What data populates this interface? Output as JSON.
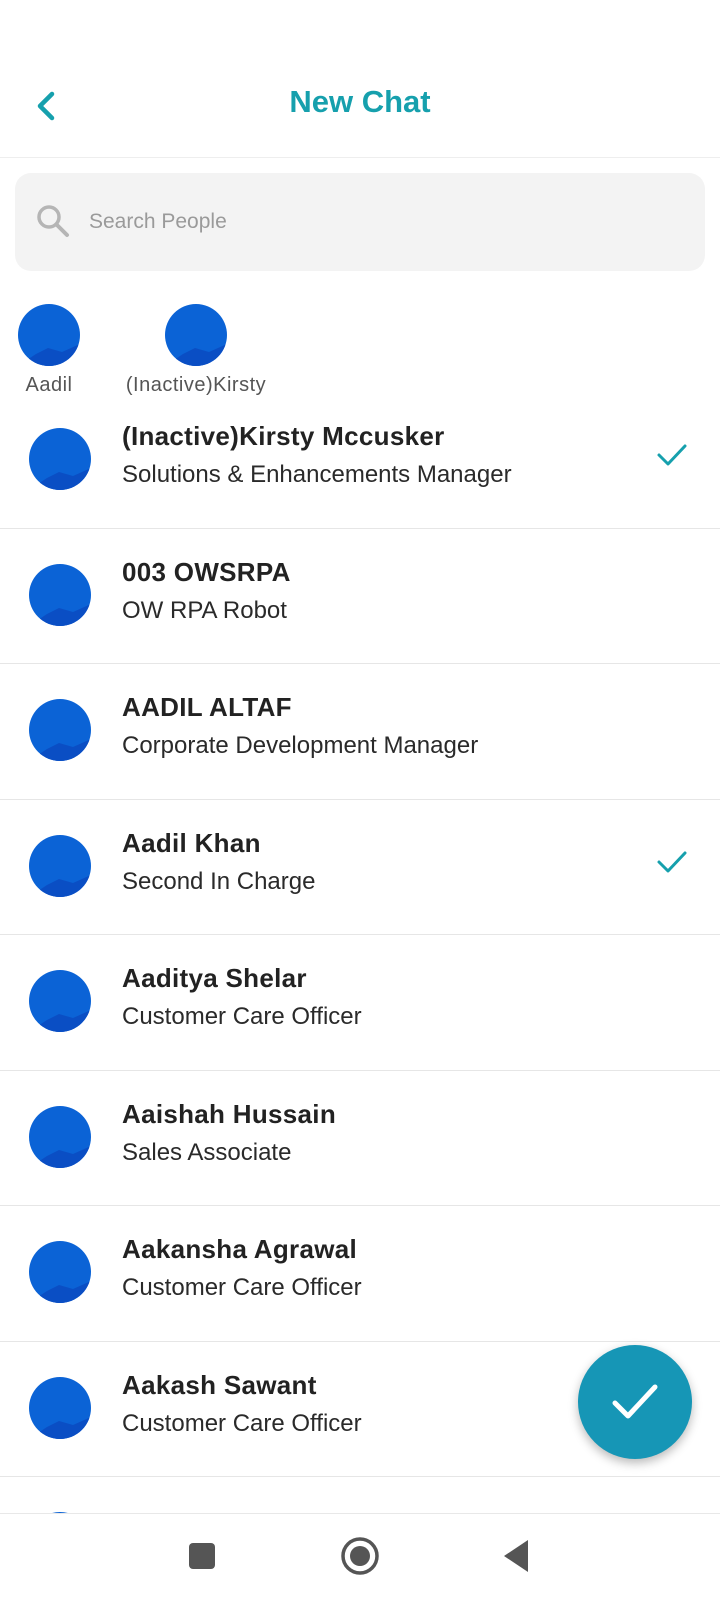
{
  "header": {
    "title": "New Chat",
    "back_icon": "chevron-left-icon",
    "accent_color": "#16a0ad"
  },
  "search": {
    "placeholder": "Search People",
    "value": ""
  },
  "selected": [
    {
      "label": "Aadil"
    },
    {
      "label": "(Inactive)Kirsty"
    }
  ],
  "contacts": [
    {
      "name": "(Inactive)Kirsty Mccusker",
      "role": "Solutions & Enhancements Manager",
      "selected": true
    },
    {
      "name": "003 OWSRPA",
      "role": "OW RPA Robot",
      "selected": false
    },
    {
      "name": "AADIL ALTAF",
      "role": "Corporate Development Manager",
      "selected": false
    },
    {
      "name": "Aadil Khan",
      "role": "Second In Charge",
      "selected": true
    },
    {
      "name": "Aaditya Shelar",
      "role": "Customer Care Officer",
      "selected": false
    },
    {
      "name": "Aaishah Hussain",
      "role": "Sales Associate",
      "selected": false
    },
    {
      "name": "Aakansha Agrawal",
      "role": "Customer Care Officer",
      "selected": false
    },
    {
      "name": "Aakash Sawant",
      "role": "Customer Care Officer",
      "selected": false
    }
  ],
  "fab": {
    "icon": "checkmark-icon",
    "color": "#1696b6"
  },
  "navbar": {
    "buttons": [
      "recents-icon",
      "home-icon",
      "back-icon"
    ]
  }
}
